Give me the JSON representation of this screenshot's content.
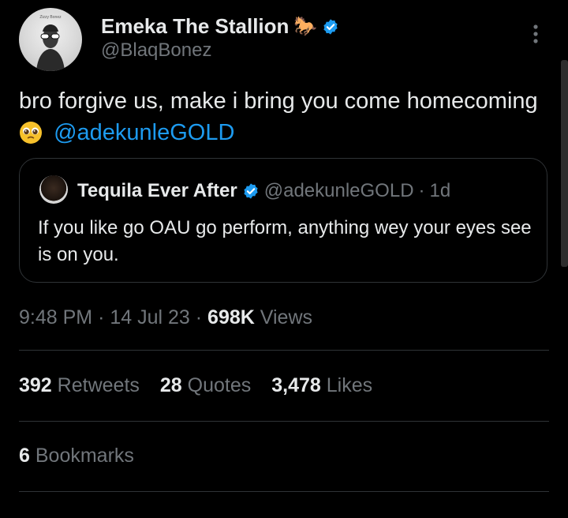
{
  "author": {
    "name": "Emeka The Stallion",
    "name_emoji": "🐎",
    "handle": "@BlaqBonez",
    "avatar_icon": "profile-photo-sunglasses",
    "avatar_top_text": "Zizzy Bonez",
    "verified": true
  },
  "tweet": {
    "text_main": "bro forgive us, make i bring you come homecoming",
    "emoji": "🥹",
    "mention": "@adekunleGOLD"
  },
  "quote": {
    "name": "Tequila Ever After",
    "handle": "@adekunleGOLD",
    "separator": "·",
    "time": "1d",
    "text": "If you like go OAU go perform, anything wey your eyes see is on you."
  },
  "meta": {
    "time": "9:48 PM",
    "sep1": "·",
    "date": "14 Jul 23",
    "sep2": "·",
    "views_count": "698K",
    "views_label": "Views"
  },
  "stats": {
    "retweets_count": "392",
    "retweets_label": "Retweets",
    "quotes_count": "28",
    "quotes_label": "Quotes",
    "likes_count": "3,478",
    "likes_label": "Likes"
  },
  "bookmarks": {
    "count": "6",
    "label": "Bookmarks"
  },
  "colors": {
    "background": "#000000",
    "text": "#e7e9ea",
    "muted": "#71767b",
    "accent": "#1d9bf0",
    "border": "#2f3336"
  }
}
